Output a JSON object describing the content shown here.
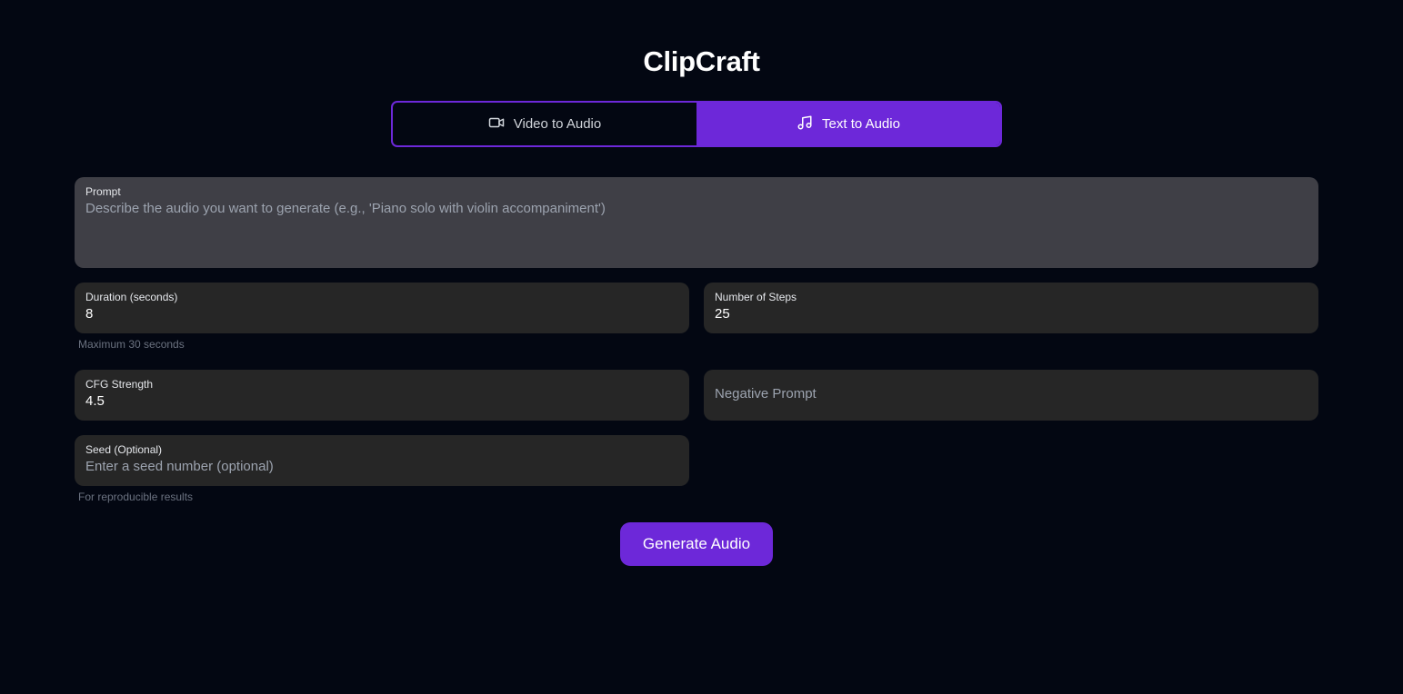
{
  "app": {
    "title": "ClipCraft"
  },
  "tabs": [
    {
      "label": "Video to Audio",
      "icon": "video-camera-icon",
      "active": false
    },
    {
      "label": "Text to Audio",
      "icon": "music-note-icon",
      "active": true
    }
  ],
  "form": {
    "prompt": {
      "label": "Prompt",
      "value": "",
      "placeholder": "Describe the audio you want to generate (e.g., 'Piano solo with violin accompaniment')"
    },
    "duration": {
      "label": "Duration (seconds)",
      "value": "8",
      "hint": "Maximum 30 seconds"
    },
    "steps": {
      "label": "Number of Steps",
      "value": "25"
    },
    "cfg": {
      "label": "CFG Strength",
      "value": "4.5"
    },
    "negative_prompt": {
      "placeholder": "Negative Prompt",
      "value": ""
    },
    "seed": {
      "label": "Seed (Optional)",
      "value": "",
      "placeholder": "Enter a seed number (optional)",
      "hint": "For reproducible results"
    }
  },
  "actions": {
    "generate_label": "Generate Audio"
  },
  "colors": {
    "accent": "#6d28d9",
    "background": "#030712",
    "field": "#262626",
    "prompt_field": "#3f3f46"
  }
}
